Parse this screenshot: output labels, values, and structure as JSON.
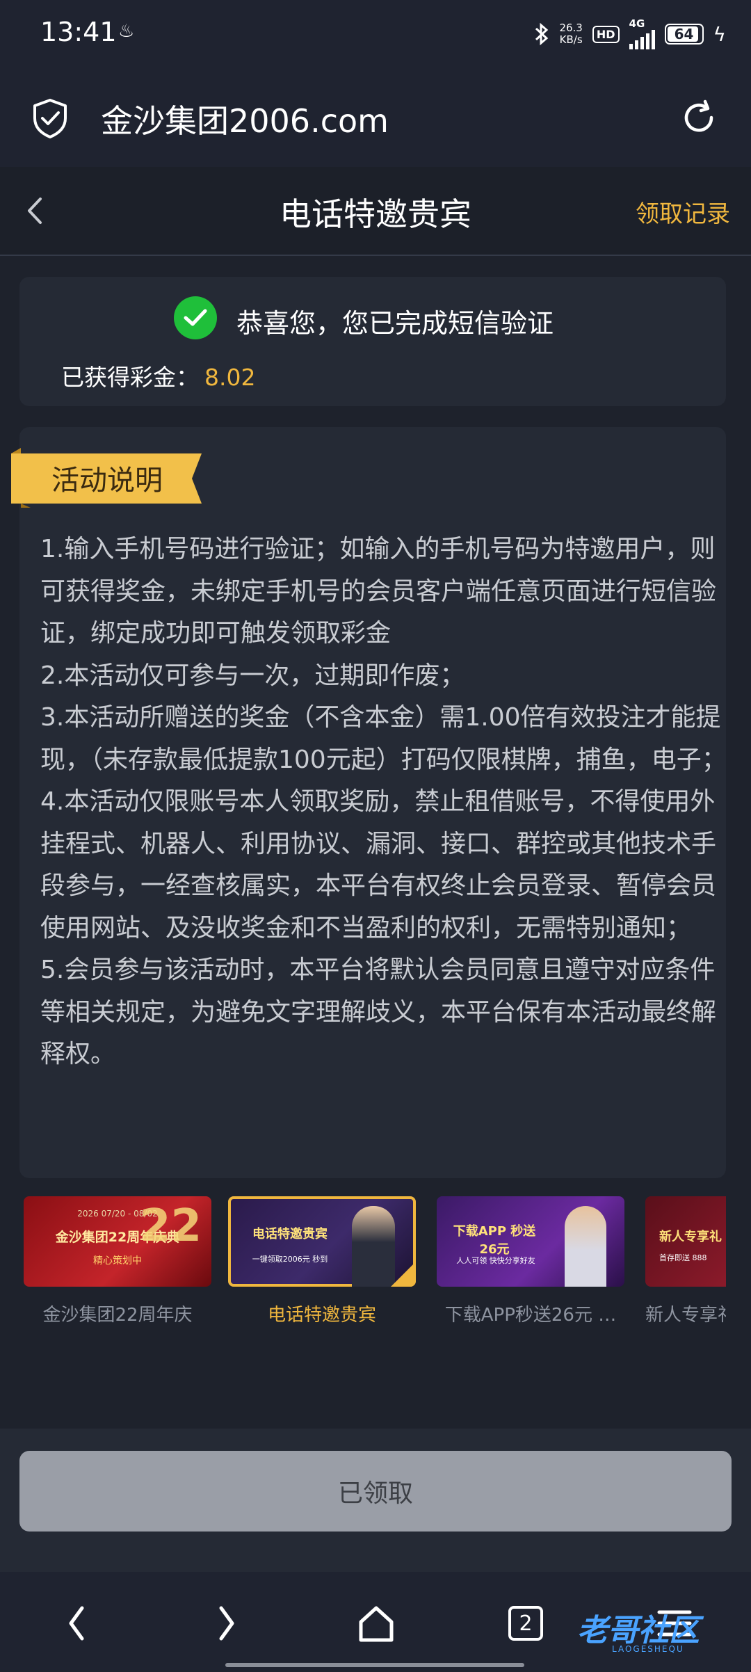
{
  "status_bar": {
    "time": "13:41",
    "speed_value": "26.3",
    "speed_unit": "KB/s",
    "hd": "HD",
    "network": "4G",
    "battery": "64"
  },
  "browser": {
    "url": "金沙集团2006.com"
  },
  "header": {
    "title": "电话特邀贵宾",
    "record_link": "领取记录"
  },
  "success": {
    "message": "恭喜您，您已完成短信验证",
    "bonus_label": "已获得彩金：",
    "bonus_value": "8.02"
  },
  "activity": {
    "ribbon_title": "活动说明",
    "rules": [
      "1.输入手机号码进行验证；如输入的手机号码为特邀用户，则可获得奖金，未绑定手机号的会员客户端任意页面进行短信验证，绑定成功即可触发领取彩金",
      "2.本活动仅可参与一次，过期即作废；",
      "3.本活动所赠送的奖金（不含本金）需1.00倍有效投注才能提现，（未存款最低提款100元起）打码仅限棋牌，捕鱼，电子；",
      "4.本活动仅限账号本人领取奖励，禁止租借账号，不得使用外挂程式、机器人、利用协议、漏洞、接口、群控或其他技术手段参与，一经查核属实，本平台有权终止会员登录、暂停会员使用网站、及没收奖金和不当盈利的权利，无需特别通知；",
      "5.会员参与该活动时，本平台将默认会员同意且遵守对应条件等相关规定，为避免文字理解歧义，本平台保有本活动最终解释权。"
    ]
  },
  "promos": [
    {
      "label": "金沙集团22周年庆",
      "banner_top": "2026 07/20 - 08/02",
      "banner_main": "金沙集团22周年庆典",
      "banner_sub": "精心策划中"
    },
    {
      "label": "电话特邀贵宾",
      "banner_main": "电话特邀贵宾",
      "banner_sub": "一键领取2006元 秒到"
    },
    {
      "label": "下载APP秒送26元 …",
      "banner_main": "下载APP 秒送26元",
      "banner_sub": "人人可领 快快分享好友"
    },
    {
      "label": "新人专享礼",
      "banner_main": "新人专享礼",
      "banner_sub": "首存即送 888"
    }
  ],
  "bottom_button": "已领取",
  "nav": {
    "tab_count": "2",
    "watermark": "老哥社区",
    "watermark_sub": "LAOGESHEQU"
  }
}
